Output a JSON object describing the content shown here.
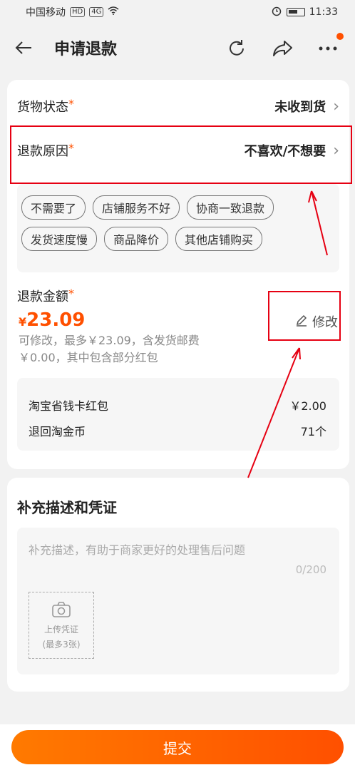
{
  "status": {
    "carrier": "中国移动",
    "hd": "HD",
    "network": "4G",
    "time": "11:33"
  },
  "nav": {
    "title": "申请退款"
  },
  "goods": {
    "label": "货物状态",
    "required": "*",
    "value": "未收到货"
  },
  "reason": {
    "label": "退款原因",
    "required": "*",
    "value": "不喜欢/不想要"
  },
  "tags": [
    "不需要了",
    "店铺服务不好",
    "协商一致退款",
    "发货速度慢",
    "商品降价",
    "其他店铺购买"
  ],
  "amount": {
    "label": "退款金额",
    "required": "*",
    "currency": "¥",
    "value": "23.09",
    "note": "可修改，最多￥23.09，含发货邮费￥0.00，其中包含部分红包",
    "edit_label": "修改"
  },
  "sub_items": [
    {
      "label": "淘宝省钱卡红包",
      "value": "￥2.00"
    },
    {
      "label": "退回淘金币",
      "value": "71个"
    }
  ],
  "description": {
    "title": "补充描述和凭证",
    "placeholder": "补充描述，有助于商家更好的处理售后问题",
    "count": "0/200",
    "upload_label": "上传凭证",
    "upload_limit": "(最多3张)"
  },
  "submit_label": "提交",
  "colors": {
    "accent": "#ff5000",
    "highlight": "#e60012"
  }
}
